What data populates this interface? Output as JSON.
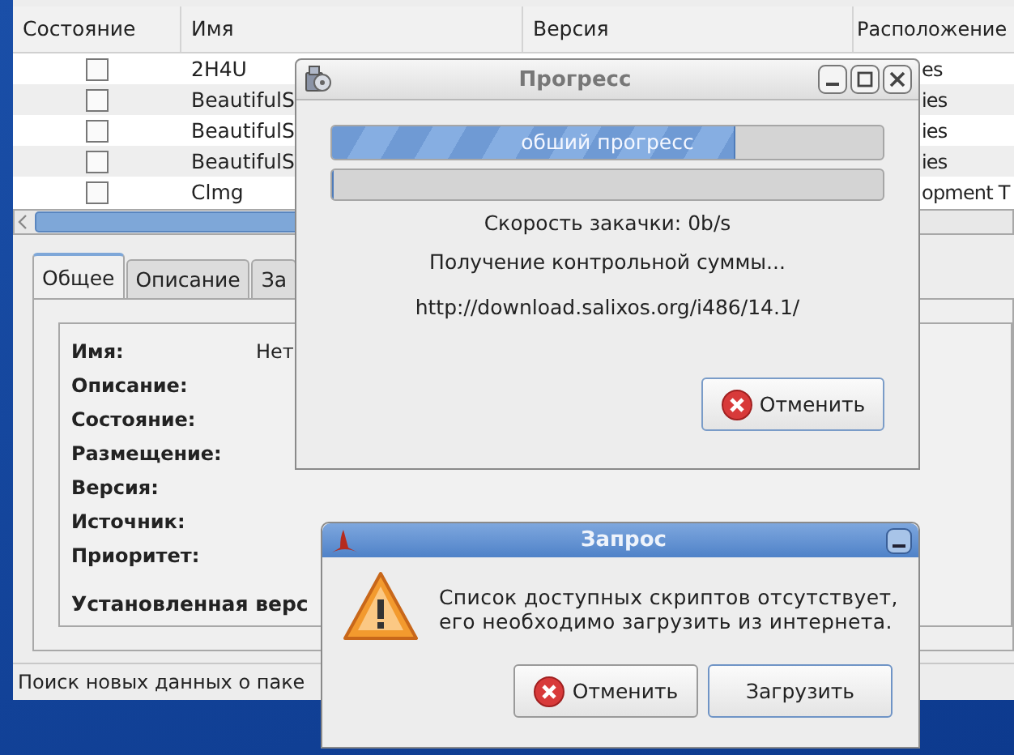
{
  "main_window": {
    "table": {
      "columns": [
        "Состояние",
        "Имя",
        "Версия",
        "Расположение"
      ],
      "rows": [
        {
          "checked": false,
          "name": "2H4U",
          "location": "es"
        },
        {
          "checked": false,
          "name": "BeautifulS",
          "location": "ies"
        },
        {
          "checked": false,
          "name": "BeautifulS",
          "location": "ies"
        },
        {
          "checked": false,
          "name": "BeautifulS",
          "location": "ies"
        },
        {
          "checked": false,
          "name": "Clmg",
          "location": "opment T"
        }
      ]
    },
    "tabs": [
      {
        "label": "Общее",
        "selected": true
      },
      {
        "label": "Описание",
        "selected": false
      },
      {
        "label": "За",
        "selected": false
      }
    ],
    "details": {
      "fields": [
        {
          "label": "Имя:",
          "value": "Нет"
        },
        {
          "label": "Описание:"
        },
        {
          "label": "Состояние:"
        },
        {
          "label": "Размещение:"
        },
        {
          "label": "Версия:"
        },
        {
          "label": "Источник:"
        },
        {
          "label": "Приоритет:"
        }
      ],
      "section": "Установленная верс"
    },
    "status_bar": "Поиск новых данных о паке"
  },
  "progress_dialog": {
    "title": "Прогресс",
    "bars": [
      {
        "label": "обший прогресс",
        "level": 0.73
      },
      {
        "level": 0
      }
    ],
    "lines": [
      "Скорость закачки: 0b/s",
      "Получение контрольной суммы...",
      "http://download.salixos.org/i486/14.1/"
    ],
    "buttons": [
      {
        "label": "Отменить",
        "kind": "cancel"
      }
    ]
  },
  "query_dialog": {
    "title": "Запрос",
    "message": [
      "Список доступных скриптов отсутствует,",
      "его необходимо загрузить из интернета."
    ],
    "buttons": [
      {
        "label": "Отменить",
        "kind": "cancel"
      },
      {
        "label": "Загрузить",
        "kind": "plain"
      }
    ]
  }
}
